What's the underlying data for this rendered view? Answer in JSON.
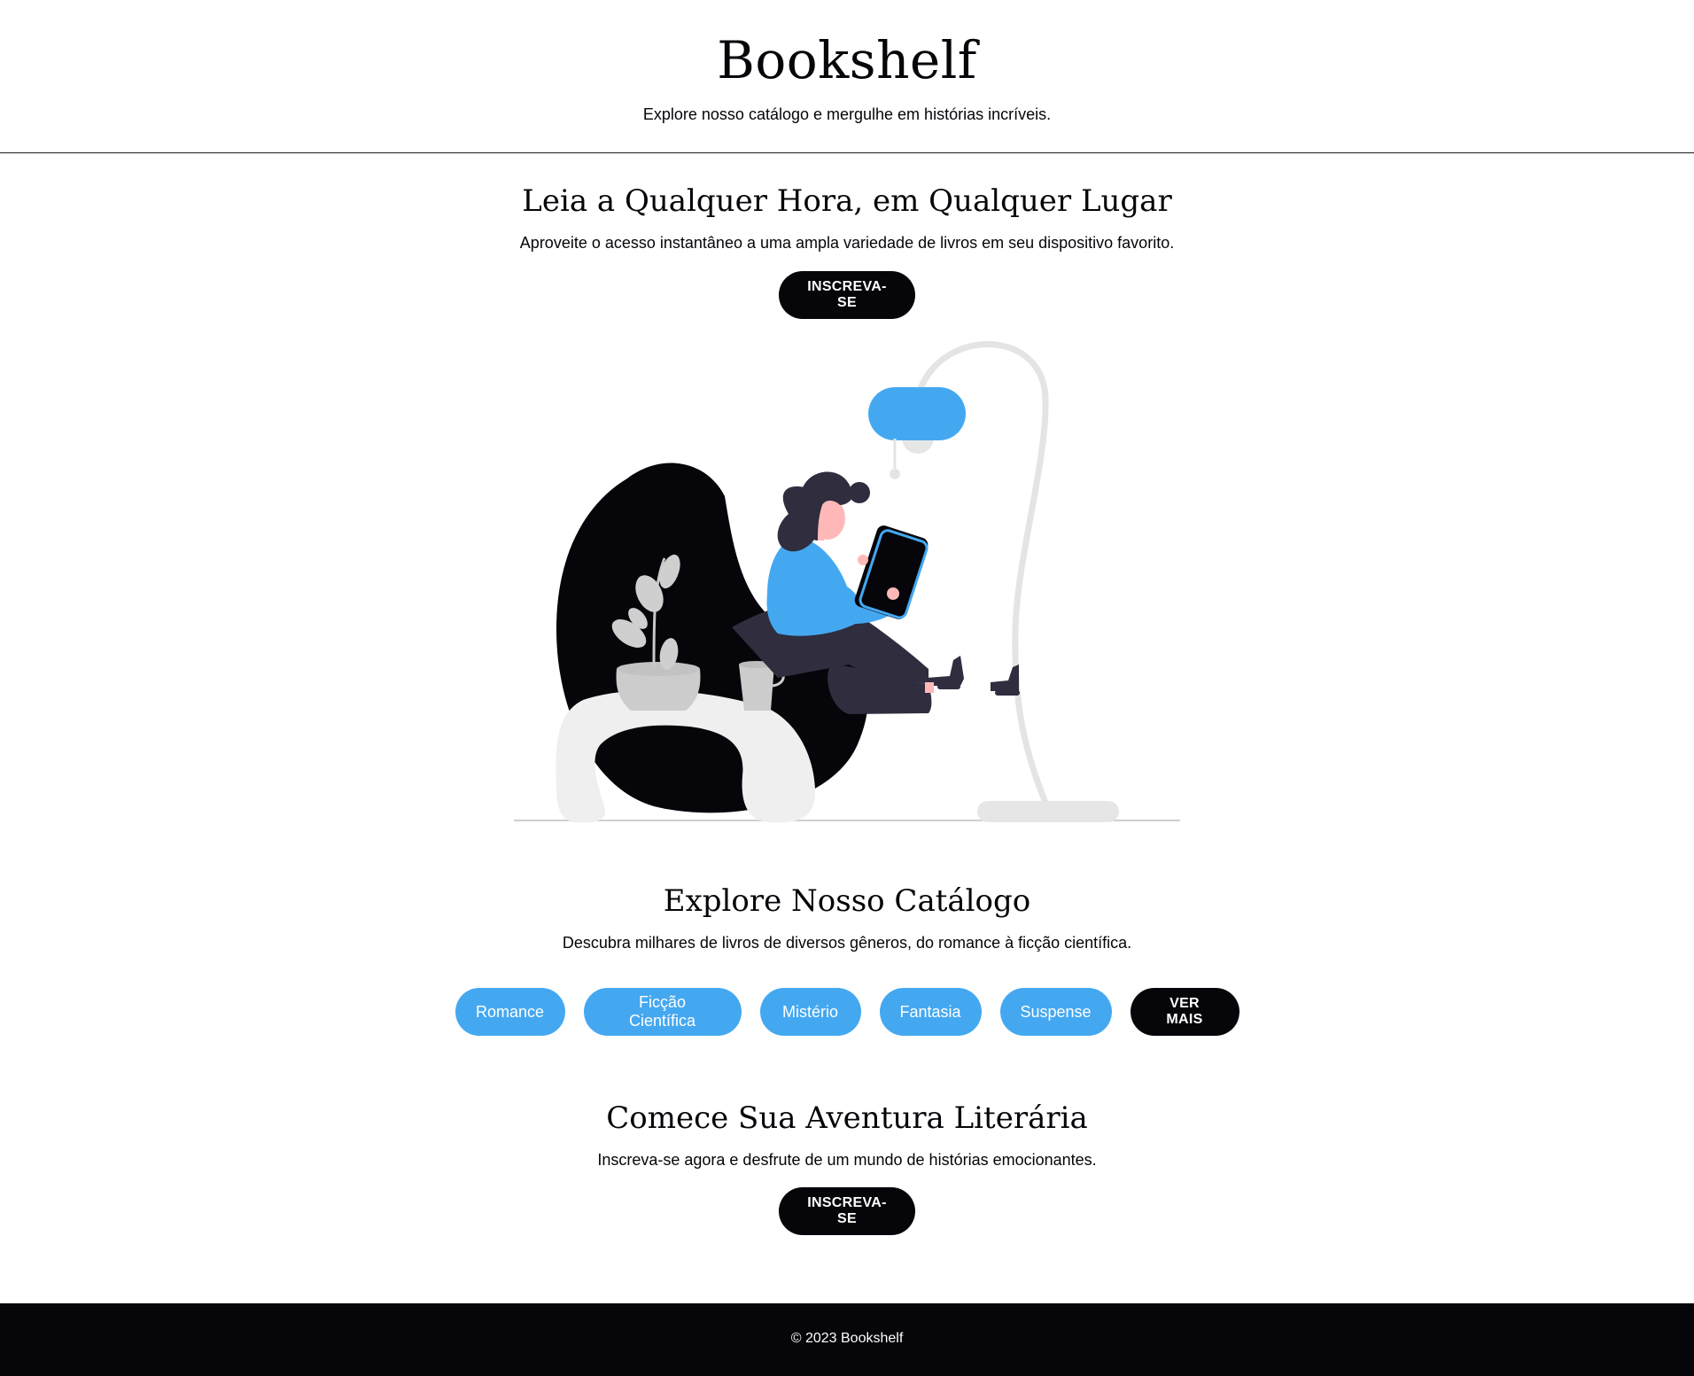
{
  "header": {
    "title": "Bookshelf",
    "subtitle": "Explore nosso catálogo e mergulhe em histórias incríveis."
  },
  "hero": {
    "heading": "Leia a Qualquer Hora, em Qualquer Lugar",
    "text": "Aproveite o acesso instantâneo a uma ampla variedade de livros em seu dispositivo favorito.",
    "cta_label": "INSCREVA-SE",
    "illustration_icon": "woman-reading-illustration"
  },
  "catalog": {
    "heading": "Explore Nosso Catálogo",
    "text": "Descubra milhares de livros de diversos gêneros, do romance à ficção científica.",
    "genres": [
      "Romance",
      "Ficção Científica",
      "Mistério",
      "Fantasia",
      "Suspense"
    ],
    "more_label": "VER MAIS"
  },
  "signup": {
    "heading": "Comece Sua Aventura Literária",
    "text": "Inscreva-se agora e desfrute de um mundo de histórias emocionantes.",
    "cta_label": "INSCREVA-SE"
  },
  "footer": {
    "copyright": "© 2023 Bookshelf"
  },
  "colors": {
    "accent": "#44a8f1",
    "dark": "#05050a",
    "background": "#ffffff"
  }
}
